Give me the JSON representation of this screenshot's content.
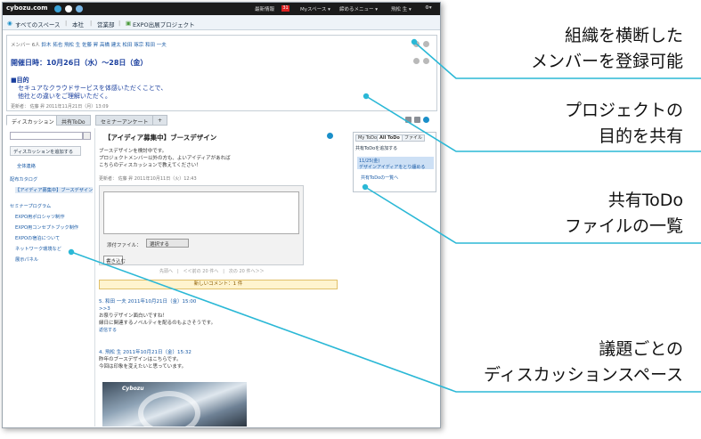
{
  "topbar": {
    "logo": "cybozu.com",
    "news_label": "最新情報",
    "news_count": "31",
    "myspace": "Myスペース ▾",
    "shime": "締めるメニュー ▾",
    "user": "飛松 生 ▾"
  },
  "breadcrumb": {
    "all_spaces": "すべてのスペース",
    "head_office": "本社",
    "sales": "営業部",
    "project": "EXPO出展プロジェクト"
  },
  "project": {
    "members_label": "メンバー 6人",
    "members": [
      "鈴木 拓也",
      "飛松 生",
      "佐藤 昇",
      "高橋 建太",
      "松田 琢宗",
      "和田 一夫"
    ],
    "dates": "開催日時：10月26日（水）〜28日（金）",
    "purpose_heading": "■目的",
    "purpose_line1": "セキュアなクラウドサービスを体感いただくことで、",
    "purpose_line2": "他社との違いをご理解いただく。",
    "updated": "更新者：  佐藤 昇    2011年11月21日（月）13:09"
  },
  "tabs": {
    "discussion": "ディスカッション",
    "shared_todo": "共有ToDo",
    "seminar_survey": "セミナーアンケート",
    "add": "+"
  },
  "sidebar": {
    "add_discussion": "ディスカッションを追加する",
    "all": "全体連絡",
    "group1": "配布カタログ",
    "item_selected": "【アイディア募集中】ブースデザイン",
    "group2": "セミナープログラム",
    "items": [
      "EXPO用ポロシャツ制作",
      "EXPO用コンセプトブック制作",
      "EXPOの宿泊について",
      "ネットワーク環境など",
      "展示パネル"
    ]
  },
  "discussion": {
    "title": "【アイディア募集中】ブースデザイン",
    "body1": "ブースデザインを検討中です。",
    "body2": "プロジェクトメンバー以外の方も、よいアイディアがあれば",
    "body3": "こちらのディスカッションで教えてください！",
    "updated": "更新者：  佐藤 昇    2011年10月11日（火）12:43",
    "file_label": "添付ファイル：",
    "file_button": "選択する",
    "post_button": "書き込む",
    "pager": "先頭へ　|　＜＜前の 20 件へ　|　次の 20 件へ＞＞",
    "new_comments": "新しいコメント：1 件",
    "c5_head": "5.  和田 一夫   2011年10月21日（金）15:00",
    "c5_ref": ">>3",
    "c5_l1": "お祭りデザイン面白いですね！",
    "c5_l2": "縁日に関連するノベルティを配るのもよさそうです。",
    "c5_reply": "返信する",
    "c4_head": "4.  飛松 生   2011年10月21日（金）15:32",
    "c4_l1": "昨年のブースデザインはこちらです。",
    "c4_l2": "今回は印象を変えたいと思っています。",
    "photo_brand": "Cybozu"
  },
  "todo_panel": {
    "tab_my": "My ToDo",
    "tab_all": "All ToDo",
    "tab_file": "ファイル",
    "add": "共有ToDoを追加する",
    "item_date": "11/25(金)",
    "item_text": "デザインアイディアをとり纏める",
    "list_link": "共有ToDoの一覧へ"
  },
  "callouts": {
    "c1_l1": "組織を横断した",
    "c1_l2": "メンバーを登録可能",
    "c2_l1": "プロジェクトの",
    "c2_l2": "目的を共有",
    "c3_l1": "共有ToDo",
    "c3_l2": "ファイルの一覧",
    "c4_l1": "議題ごとの",
    "c4_l2": "ディスカッションスペース"
  },
  "colors": {
    "callout_line": "#2bb8d6",
    "link": "#1a5ba6",
    "heading": "#1a3f9e"
  }
}
